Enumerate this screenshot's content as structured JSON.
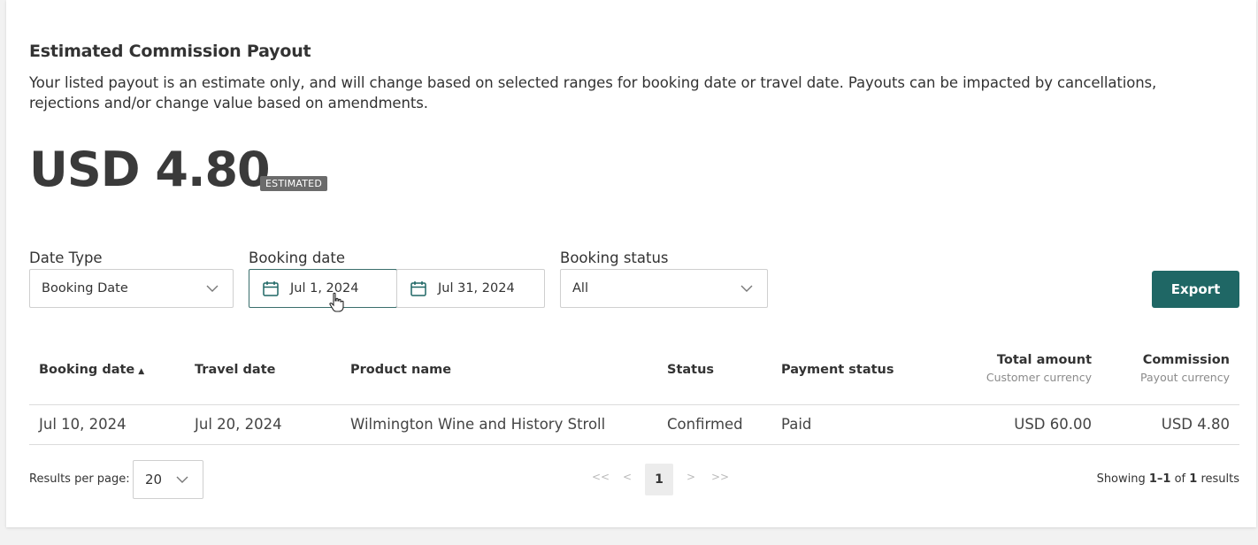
{
  "payout": {
    "title": "Estimated Commission Payout",
    "description": "Your listed payout is an estimate only, and will change based on selected ranges for booking date or travel date. Payouts can be impacted by cancellations, rejections and/or change value based on amendments.",
    "amount": "USD 4.80",
    "badge": "ESTIMATED"
  },
  "filters": {
    "date_type": {
      "label": "Date Type",
      "value": "Booking Date"
    },
    "booking_date": {
      "label": "Booking date",
      "start": "Jul 1, 2024",
      "end": "Jul 31, 2024"
    },
    "booking_status": {
      "label": "Booking status",
      "value": "All"
    },
    "export_label": "Export"
  },
  "table": {
    "headers": {
      "booking_date": "Booking date",
      "travel_date": "Travel date",
      "product_name": "Product name",
      "status": "Status",
      "payment_status": "Payment status",
      "total_amount": "Total amount",
      "total_amount_sub": "Customer currency",
      "commission": "Commission",
      "commission_sub": "Payout currency"
    },
    "rows": [
      {
        "booking_date": "Jul 10, 2024",
        "travel_date": "Jul 20, 2024",
        "product_name": "Wilmington Wine and History Stroll",
        "status": "Confirmed",
        "payment_status": "Paid",
        "total_amount": "USD 60.00",
        "commission": "USD 4.80"
      }
    ]
  },
  "pagination": {
    "results_per_page_label": "Results per page:",
    "results_per_page": "20",
    "first": "<<",
    "prev": "<",
    "current_page": "1",
    "next": ">",
    "last": ">>",
    "showing_prefix": "Showing ",
    "showing_range": "1–1",
    "showing_of": " of ",
    "showing_total": "1",
    "showing_suffix": " results"
  },
  "colors": {
    "accent": "#1f6765",
    "badge": "#6b6b6b"
  },
  "icons": {
    "calendar": "calendar-icon",
    "chevron": "chevron-down-icon",
    "sort": "sort-ascending-icon",
    "cursor": "hand-pointer-icon"
  }
}
